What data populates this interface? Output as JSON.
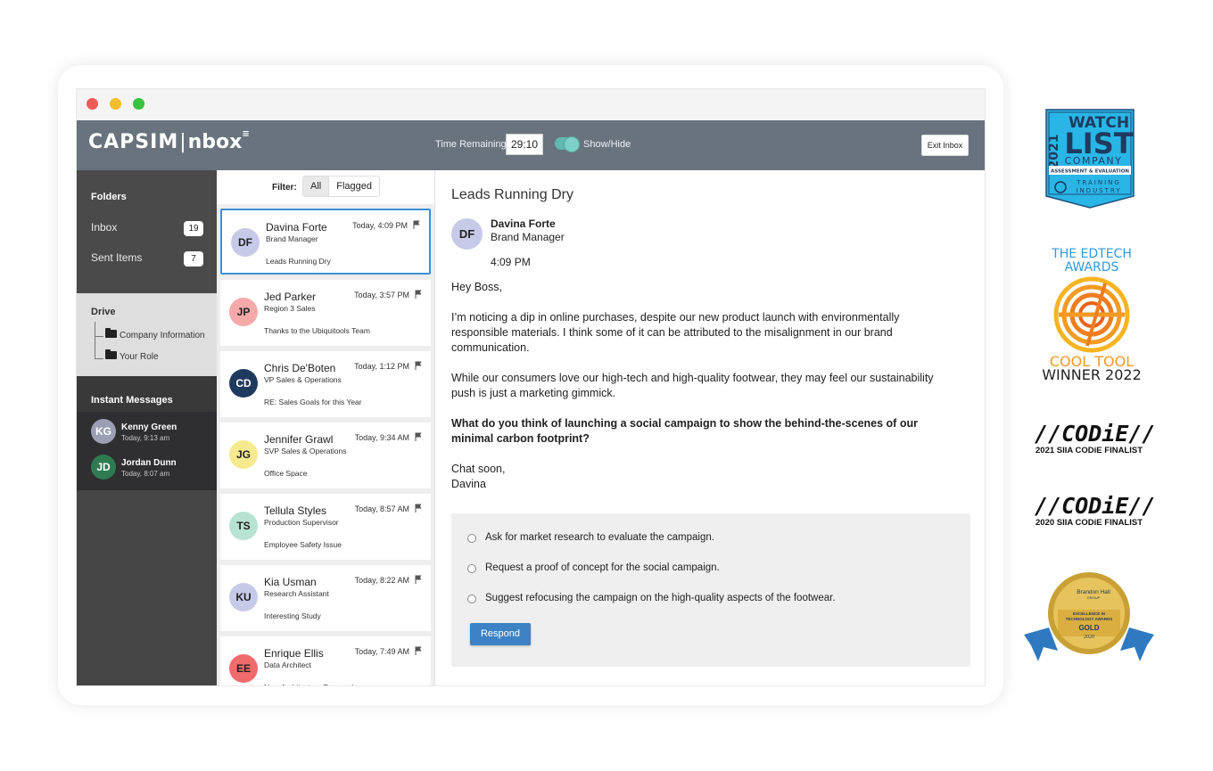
{
  "app": {
    "logo_left": "CAPSIM",
    "logo_sep": "|",
    "logo_right": "nbox",
    "time_label": "Time Remaining",
    "time_value": "29:10",
    "toggle_label": "Show/Hide",
    "exit_label": "Exit Inbox"
  },
  "sidebar": {
    "folders_heading": "Folders",
    "folders": [
      {
        "label": "Inbox",
        "count": "19"
      },
      {
        "label": "Sent Items",
        "count": "7"
      }
    ],
    "drive_heading": "Drive",
    "drive_items": [
      "Company Information",
      "Your Role"
    ],
    "im_heading": "Instant Messages",
    "im_items": [
      {
        "initials": "KG",
        "name": "Kenny Green",
        "time": "Today, 9:13 am",
        "color": "#9a9fb5"
      },
      {
        "initials": "JD",
        "name": "Jordan Dunn",
        "time": "Today, 8:07 am",
        "color": "#2f7a52"
      }
    ]
  },
  "filter": {
    "label": "Filter:",
    "options": [
      "All",
      "Flagged"
    ],
    "active": "All"
  },
  "messages": [
    {
      "initials": "DF",
      "name": "Davina Forte",
      "role": "Brand Manager",
      "subject": "Leads Running Dry",
      "time": "Today, 4:09 PM",
      "color": "#c7c9e8",
      "selected": true
    },
    {
      "initials": "JP",
      "name": "Jed Parker",
      "role": "Region 3 Sales",
      "subject": "Thanks to the Ubiquitools Team",
      "time": "Today, 3:57 PM",
      "color": "#f5a9a9"
    },
    {
      "initials": "CD",
      "name": "Chris De'Boten",
      "role": "VP Sales & Operations",
      "subject": "RE: Sales Goals for this Year",
      "time": "Today, 1:12 PM",
      "color": "#1f3a5f"
    },
    {
      "initials": "JG",
      "name": "Jennifer Grawl",
      "role": "SVP Sales & Operations",
      "subject": "Office Space",
      "time": "Today, 9:34 AM",
      "color": "#f6ea8e"
    },
    {
      "initials": "TS",
      "name": "Tellula Styles",
      "role": "Production Supervisor",
      "subject": "Employee Safety Issue",
      "time": "Today, 8:57 AM",
      "color": "#b8e2d1"
    },
    {
      "initials": "KU",
      "name": "Kia Usman",
      "role": "Research Assistant",
      "subject": "Interesting Study",
      "time": "Today, 8:22 AM",
      "color": "#c7c9e8"
    },
    {
      "initials": "EE",
      "name": "Enrique Ellis",
      "role": "Data Architect",
      "subject": "New Architecture Proposal",
      "time": "Today, 7:49 AM",
      "color": "#f06b6b"
    }
  ],
  "reader": {
    "subject": "Leads Running Dry",
    "sender_initials": "DF",
    "sender_name": "Davina Forte",
    "sender_role": "Brand Manager",
    "sent_time": "4:09 PM",
    "greeting": "Hey Boss,",
    "p1": "I’m noticing a dip in online purchases, despite our new product launch with environmentally responsible materials. I think some of it can be attributed to the misalignment in our brand communication.",
    "p2": "While our consumers love our high-tech and high-quality footwear, they may feel our sustainability push is just a marketing gimmick.",
    "p3": "What do you think of launching a social campaign to show the behind-the-scenes of our minimal carbon footprint?",
    "closing1": "Chat soon,",
    "closing2": "Davina",
    "choices": [
      "Ask for market research to evaluate the campaign.",
      "Request a proof of concept for the social campaign.",
      "Suggest refocusing the campaign on the high-quality aspects of the footwear."
    ],
    "respond_label": "Respond"
  },
  "awards": {
    "watch_year": "2021",
    "watch_line1": "WATCH",
    "watch_line2": "LIST",
    "watch_line3": "COMPANY",
    "watch_line4": "ASSESSMENT & EVALUATION",
    "watch_line5": "TRAINING",
    "watch_line6": "INDUSTRY",
    "edtech_line1": "THE EDTECH",
    "edtech_line2": "AWARDS",
    "edtech_cool": "COOL TOOL",
    "edtech_winner": "WINNER 2022",
    "codie_mark": "//CODiE//",
    "codie_2021": "2021 SIIA CODiE FINALIST",
    "codie_2020": "2020 SIIA CODiE FINALIST",
    "brandon_name": "Brandon Hall",
    "brandon_group": "GROUP",
    "brandon_line1": "EXCELLENCE IN",
    "brandon_line2": "TECHNOLOGY AWARDS",
    "brandon_gold": "GOLD",
    "brandon_year": "2020"
  }
}
